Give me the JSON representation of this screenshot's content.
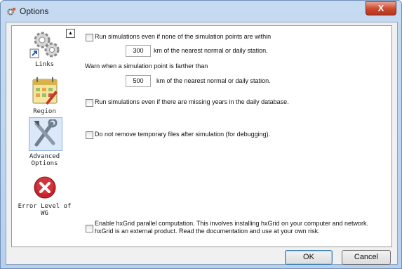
{
  "window": {
    "title": "Options",
    "close_symbol": "X"
  },
  "sidebar": {
    "items": [
      {
        "label": "Links",
        "icon": "links-gears-icon"
      },
      {
        "label": "Region",
        "icon": "region-calendar-icon"
      },
      {
        "label_line1": "Advanced",
        "label_line2": "Options",
        "icon": "advanced-tools-icon",
        "selected": true
      },
      {
        "label_line1": "Error Level of",
        "label_line2": "WG",
        "icon": "error-icon"
      }
    ]
  },
  "options": {
    "run_outside_radius": {
      "label": "Run simulations even if none of the simulation points are within",
      "value": "300",
      "suffix": "km of the nearest normal or daily station.",
      "checked": false
    },
    "warn_distance": {
      "label": "Warn when a simulation point is farther than",
      "value": "500",
      "suffix": "km of the nearest normal or daily station."
    },
    "missing_years": {
      "label": "Run simulations even if there are missing years in the daily database.",
      "checked": false
    },
    "keep_temp": {
      "label": "Do not remove temporary files after simulation (for debugging).",
      "checked": false
    },
    "hxgrid": {
      "line1": "Enable hxGrid parallel computation. This involves installing hxGrid on your computer and network.",
      "line2": "hxGrid is an external product. Read the documentation and use at your own risk.",
      "checked": false
    }
  },
  "buttons": {
    "ok": "OK",
    "cancel": "Cancel"
  },
  "colors": {
    "title_bar": "#c6daf1",
    "close_button": "#c9472b",
    "error_icon": "#c8232b",
    "default_button_border": "#3c7fb1"
  }
}
